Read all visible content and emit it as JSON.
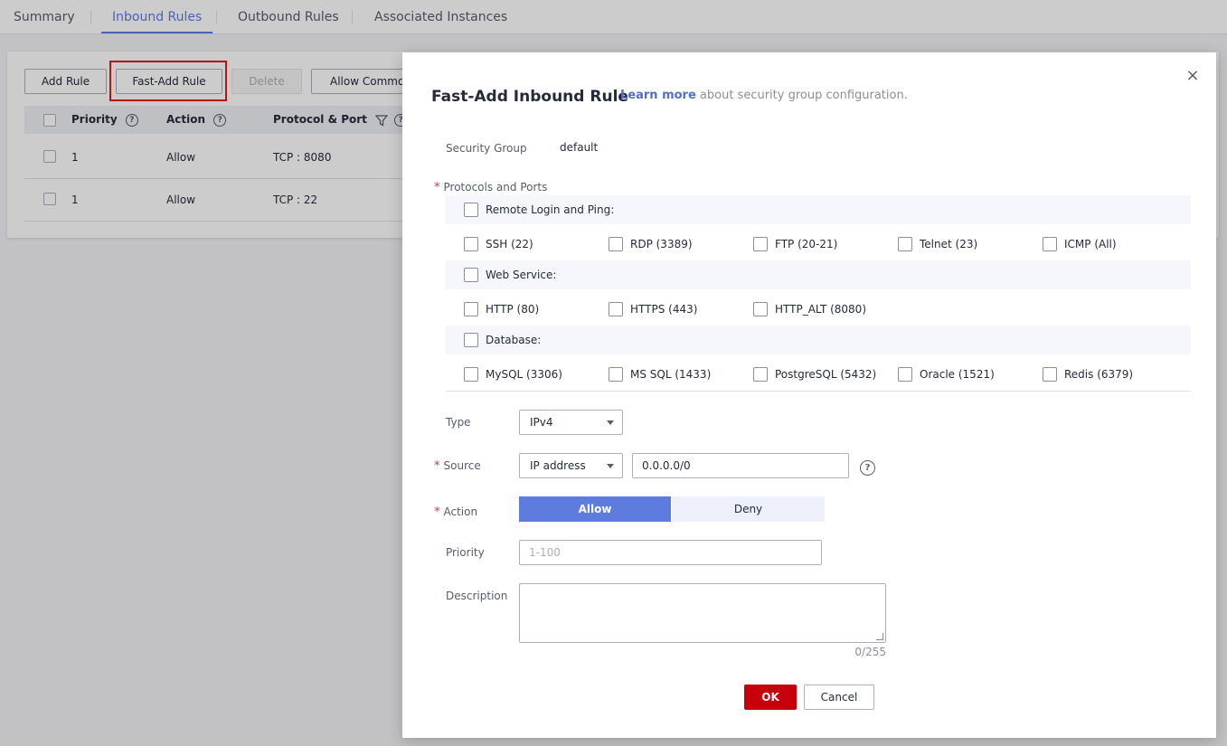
{
  "tabs": [
    {
      "label": "Summary"
    },
    {
      "label": "Inbound Rules"
    },
    {
      "label": "Outbound Rules"
    },
    {
      "label": "Associated Instances"
    }
  ],
  "toolbar": {
    "add_rule": "Add Rule",
    "fast_add_rule": "Fast-Add Rule",
    "delete": "Delete",
    "allow_common": "Allow Common Ports"
  },
  "table": {
    "headers": {
      "priority": "Priority",
      "action": "Action",
      "protocol_port": "Protocol & Port"
    },
    "rows": [
      {
        "priority": "1",
        "action": "Allow",
        "protocol_port": "TCP : 8080"
      },
      {
        "priority": "1",
        "action": "Allow",
        "protocol_port": "TCP : 22"
      }
    ]
  },
  "modal": {
    "title": "Fast-Add Inbound Rule",
    "learn_more": "Learn more",
    "subtitle_rest": " about security group configuration.",
    "security_group_label": "Security Group",
    "security_group_value": "default",
    "protocols_label": "Protocols and Ports",
    "groups": [
      {
        "name": "Remote Login and Ping:",
        "items": [
          "SSH (22)",
          "RDP (3389)",
          "FTP (20-21)",
          "Telnet (23)",
          "ICMP (All)"
        ]
      },
      {
        "name": "Web Service:",
        "items": [
          "HTTP (80)",
          "HTTPS (443)",
          "HTTP_ALT (8080)"
        ]
      },
      {
        "name": "Database:",
        "items": [
          "MySQL (3306)",
          "MS SQL (1433)",
          "PostgreSQL (5432)",
          "Oracle (1521)",
          "Redis (6379)"
        ]
      }
    ],
    "type_label": "Type",
    "type_value": "IPv4",
    "source_label": "Source",
    "source_type": "IP address",
    "source_value": "0.0.0.0/0",
    "action_label": "Action",
    "action_allow": "Allow",
    "action_deny": "Deny",
    "priority_label": "Priority",
    "priority_placeholder": "1-100",
    "description_label": "Description",
    "description_counter": "0/255",
    "required_mark": "*",
    "close_glyph": "×",
    "ok": "OK",
    "cancel": "Cancel"
  }
}
